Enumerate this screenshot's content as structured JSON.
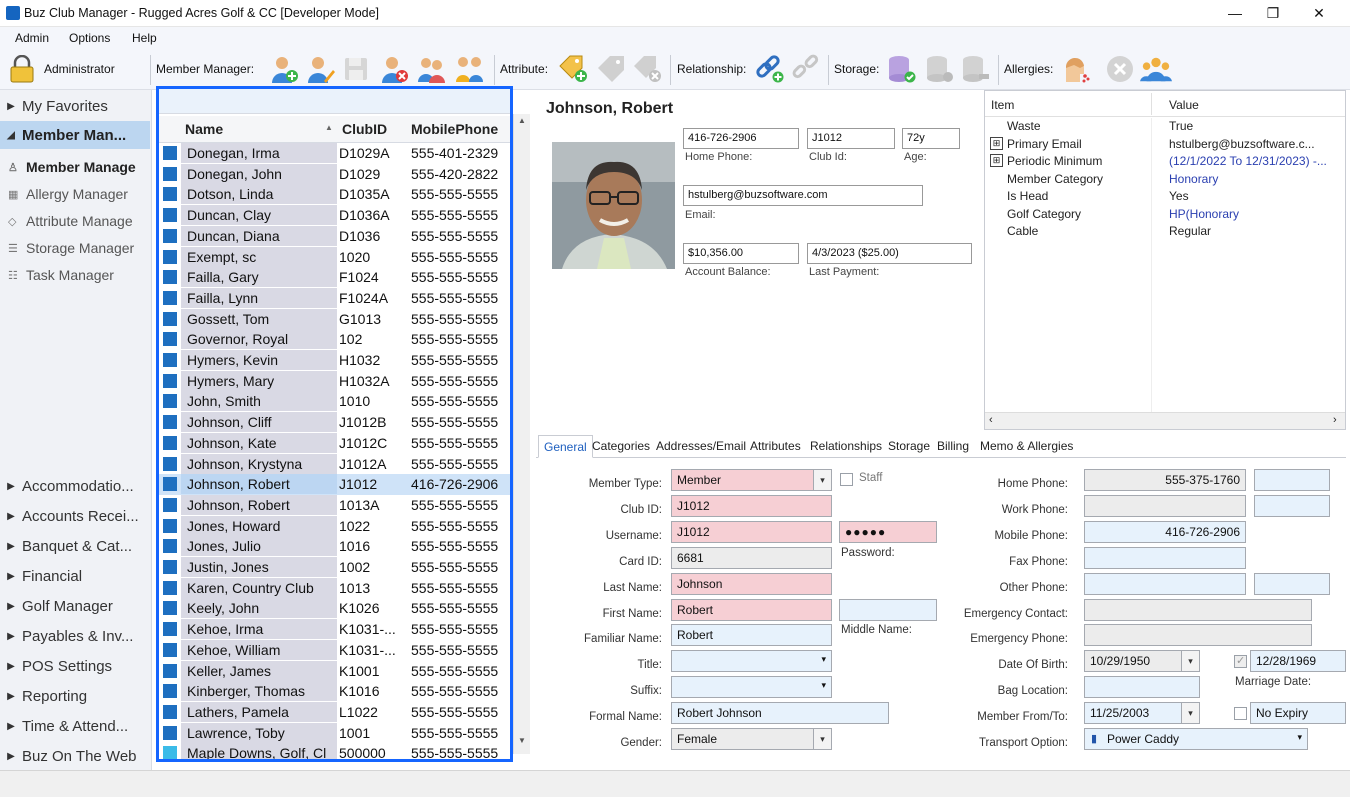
{
  "window": {
    "title": "Buz Club Manager - Rugged Acres Golf & CC [Developer Mode]",
    "min": "—",
    "max": "❐",
    "close": "✕"
  },
  "menu": [
    "Admin",
    "Options",
    "Help"
  ],
  "toolbar": {
    "user": "Administrator",
    "member_manager_label": "Member Manager:",
    "attribute_label": "Attribute:",
    "relationship_label": "Relationship:",
    "storage_label": "Storage:",
    "allergies_label": "Allergies:"
  },
  "nav": {
    "favorites": "My Favorites",
    "member_manager": "Member Man...",
    "subitems": [
      "Member Manage",
      "Allergy Manager",
      "Attribute Manage",
      "Storage Manager",
      "Task Manager"
    ],
    "sections": [
      "Accommodatio...",
      "Accounts Recei...",
      "Banquet & Cat...",
      "Financial",
      "Golf Manager",
      "Payables & Inv...",
      "POS Settings",
      "Reporting",
      "Time & Attend...",
      "Buz On The Web"
    ]
  },
  "grid": {
    "headers": {
      "name": "Name",
      "id": "ClubID",
      "phone": "MobilePhone"
    },
    "rows": [
      {
        "name": "Donegan, Irma",
        "id": "D1029A",
        "phone": "555-401-2329"
      },
      {
        "name": "Donegan, John",
        "id": "D1029",
        "phone": "555-420-2822"
      },
      {
        "name": "Dotson, Linda",
        "id": "D1035A",
        "phone": "555-555-5555"
      },
      {
        "name": "Duncan, Clay",
        "id": "D1036A",
        "phone": "555-555-5555"
      },
      {
        "name": "Duncan, Diana",
        "id": "D1036",
        "phone": "555-555-5555"
      },
      {
        "name": "Exempt, sc",
        "id": "1020",
        "phone": "555-555-5555"
      },
      {
        "name": "Failla, Gary",
        "id": "F1024",
        "phone": "555-555-5555"
      },
      {
        "name": "Failla, Lynn",
        "id": "F1024A",
        "phone": "555-555-5555"
      },
      {
        "name": "Gossett, Tom",
        "id": "G1013",
        "phone": "555-555-5555"
      },
      {
        "name": "Governor, Royal",
        "id": "102",
        "phone": "555-555-5555"
      },
      {
        "name": "Hymers, Kevin",
        "id": "H1032",
        "phone": "555-555-5555"
      },
      {
        "name": "Hymers, Mary",
        "id": "H1032A",
        "phone": "555-555-5555"
      },
      {
        "name": "John, Smith",
        "id": "1010",
        "phone": "555-555-5555"
      },
      {
        "name": "Johnson, Cliff",
        "id": "J1012B",
        "phone": "555-555-5555"
      },
      {
        "name": "Johnson, Kate",
        "id": "J1012C",
        "phone": "555-555-5555"
      },
      {
        "name": "Johnson, Krystyna",
        "id": "J1012A",
        "phone": "555-555-5555"
      },
      {
        "name": "Johnson, Robert",
        "id": "J1012",
        "phone": "416-726-2906"
      },
      {
        "name": "Johnson, Robert",
        "id": "1013A",
        "phone": "555-555-5555"
      },
      {
        "name": "Jones, Howard",
        "id": "1022",
        "phone": "555-555-5555"
      },
      {
        "name": "Jones, Julio",
        "id": "1016",
        "phone": "555-555-5555"
      },
      {
        "name": "Justin, Jones",
        "id": "1002",
        "phone": "555-555-5555"
      },
      {
        "name": "Karen, Country Club",
        "id": "1013",
        "phone": "555-555-5555"
      },
      {
        "name": "Keely, John",
        "id": "K1026",
        "phone": "555-555-5555"
      },
      {
        "name": "Kehoe, Irma",
        "id": "K1031-...",
        "phone": "555-555-5555"
      },
      {
        "name": "Kehoe, William",
        "id": "K1031-...",
        "phone": "555-555-5555"
      },
      {
        "name": "Keller, James",
        "id": "K1001",
        "phone": "555-555-5555"
      },
      {
        "name": "Kinberger, Thomas",
        "id": "K1016",
        "phone": "555-555-5555"
      },
      {
        "name": "Lathers, Pamela",
        "id": "L1022",
        "phone": "555-555-5555"
      },
      {
        "name": "Lawrence, Toby",
        "id": "1001",
        "phone": "555-555-5555"
      },
      {
        "name": "Maple Downs, Golf, Cl",
        "id": "500000",
        "phone": "555-555-5555"
      }
    ]
  },
  "detail": {
    "name": "Johnson, Robert",
    "home_phone": "416-726-2906",
    "home_phone_label": "Home Phone:",
    "club_id": "J1012",
    "club_id_label": "Club Id:",
    "age": "72y",
    "age_label": "Age:",
    "email": "hstulberg@buzsoftware.com",
    "email_label": "Email:",
    "balance": "$10,356.00",
    "balance_label": "Account Balance:",
    "last_payment": "4/3/2023 ($25.00)",
    "last_payment_label": "Last Payment:"
  },
  "attributes": {
    "headers": {
      "item": "Item",
      "value": "Value"
    },
    "rows": [
      {
        "item": "Waste",
        "value": "True"
      },
      {
        "item": "Primary Email",
        "value": "hstulberg@buzsoftware.c..."
      },
      {
        "item": "Periodic Minimum",
        "value": "(12/1/2022 To 12/31/2023) -..."
      },
      {
        "item": "Member Category",
        "value": "Honorary"
      },
      {
        "item": "Is Head",
        "value": "Yes"
      },
      {
        "item": "Golf Category",
        "value": "HP(Honorary"
      },
      {
        "item": "Cable",
        "value": "Regular"
      }
    ]
  },
  "tabs": [
    "General",
    "Categories",
    "Addresses/Email",
    "Attributes",
    "Relationships",
    "Storage",
    "Billing",
    "Memo & Allergies"
  ],
  "form": {
    "member_type_label": "Member Type:",
    "member_type": "Member",
    "staff_label": "Staff",
    "club_id_label": "Club ID:",
    "club_id": "J1012",
    "username_label": "Username:",
    "username": "J1012",
    "password": "●●●●●",
    "password_label": "Password:",
    "card_id_label": "Card ID:",
    "card_id": "6681",
    "last_name_label": "Last Name:",
    "last_name": "Johnson",
    "first_name_label": "First Name:",
    "first_name": "Robert",
    "familiar_name_label": "Familiar Name:",
    "familiar_name": "Robert",
    "middle_name_label": "Middle Name:",
    "title_label": "Title:",
    "suffix_label": "Suffix:",
    "formal_name_label": "Formal Name:",
    "formal_name": "Robert Johnson",
    "gender_label": "Gender:",
    "gender": "Female",
    "home_phone_label": "Home Phone:",
    "home_phone": "555-375-1760",
    "work_phone_label": "Work Phone:",
    "mobile_phone_label": "Mobile Phone:",
    "mobile_phone": "416-726-2906",
    "fax_phone_label": "Fax Phone:",
    "other_phone_label": "Other Phone:",
    "emergency_contact_label": "Emergency Contact:",
    "emergency_phone_label": "Emergency Phone:",
    "dob_label": "Date Of Birth:",
    "dob": "10/29/1950",
    "marriage_date": "12/28/1969",
    "marriage_label": "Marriage Date:",
    "bag_location_label": "Bag Location:",
    "member_from_label": "Member From/To:",
    "member_from": "11/25/2003",
    "member_to": "No Expiry",
    "transport_label": "Transport Option:",
    "transport": "Power Caddy"
  },
  "colors": {
    "accent": "#1565ff",
    "required": "#f6cfd4",
    "optional": "#e7f2fc"
  }
}
